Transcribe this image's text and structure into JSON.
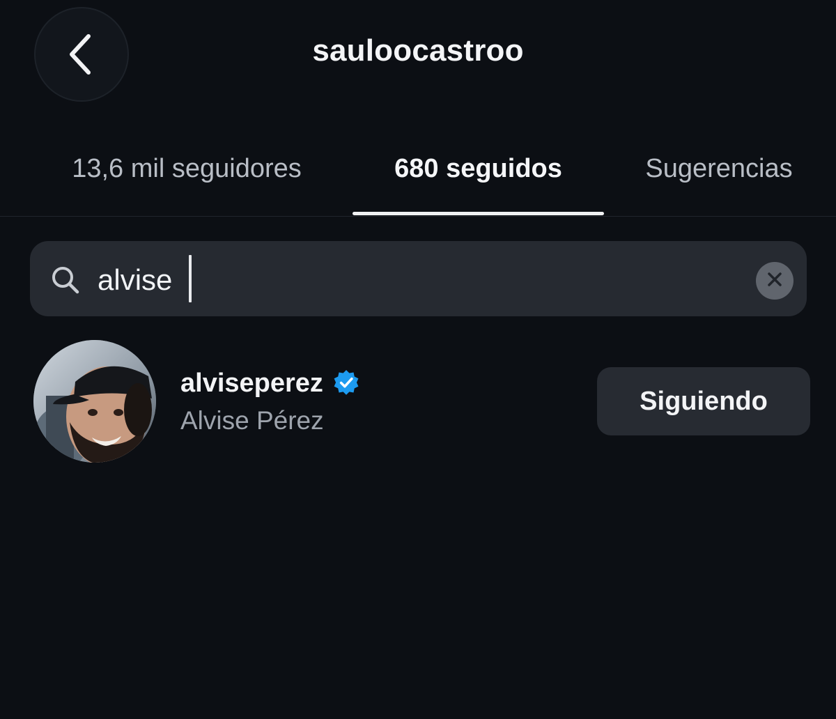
{
  "header": {
    "title": "sauloocastroo",
    "back_icon": "chevron-left-icon"
  },
  "tabs": [
    {
      "label": "13,6 mil seguidores",
      "active": false
    },
    {
      "label": "680 seguidos",
      "active": true
    },
    {
      "label": "Sugerencias",
      "active": false
    }
  ],
  "search": {
    "icon": "search-icon",
    "value": "alvise",
    "clear_icon": "close-icon"
  },
  "results": [
    {
      "username": "alviseperez",
      "verified": true,
      "full_name": "Alvise Pérez",
      "action_label": "Siguiendo"
    }
  ],
  "colors": {
    "background": "#0c0f14",
    "surface": "#262a31",
    "text_primary": "#f3f4f6",
    "text_secondary": "#9ea4ad",
    "verified_blue": "#1d9bf0"
  }
}
